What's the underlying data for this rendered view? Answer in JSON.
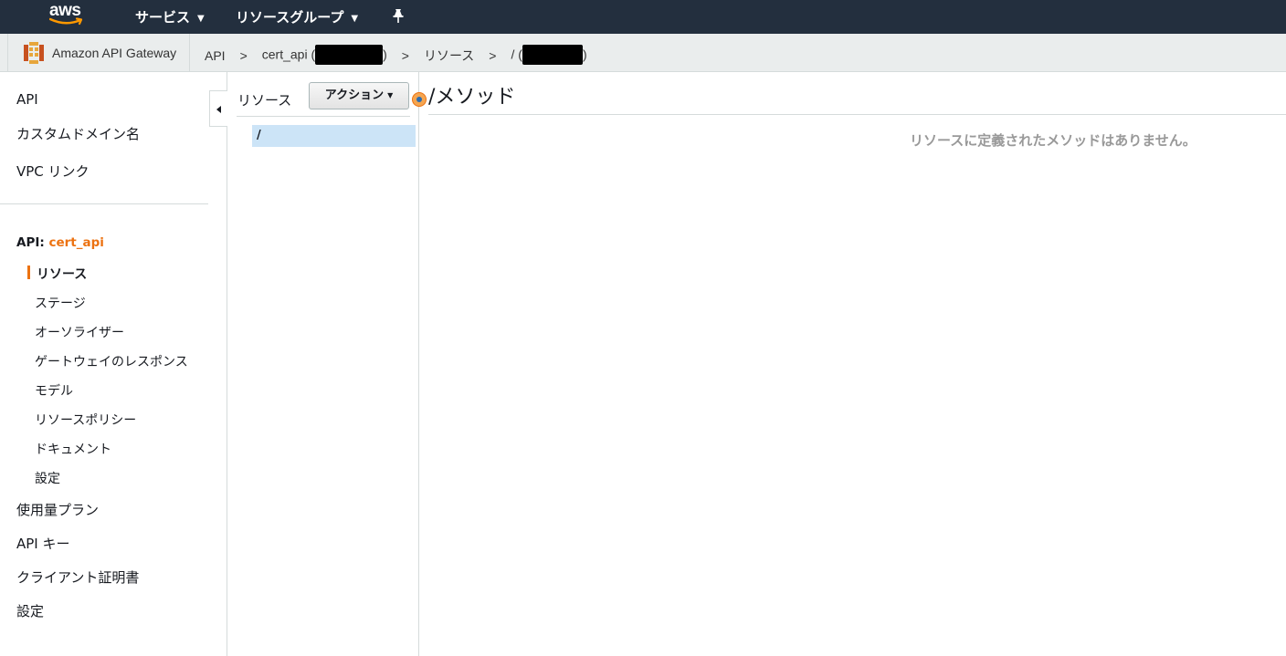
{
  "topbar": {
    "logo_text": "aws",
    "services_label": "サービス",
    "resource_groups_label": "リソースグループ",
    "pin_icon": "pin-icon",
    "colors": {
      "background": "#232f3e",
      "smile": "#ff9900"
    }
  },
  "breadcrumb": {
    "service_name": "Amazon API Gateway",
    "service_icon": "api-gateway-icon",
    "items": [
      "API",
      "cert_api (",
      ")",
      "リソース",
      "/ (",
      ")"
    ],
    "separator": ">"
  },
  "sidebar": {
    "top_items": [
      "API",
      "カスタムドメイン名",
      "VPC リンク"
    ],
    "api_prefix": "API: ",
    "api_name": "cert_api",
    "api_items": [
      "リソース",
      "ステージ",
      "オーソライザー",
      "ゲートウェイのレスポンス",
      "モデル",
      "リソースポリシー",
      "ドキュメント",
      "設定"
    ],
    "active_item": "リソース",
    "bottom_items": [
      "使用量プラン",
      "API キー",
      "クライアント証明書",
      "設定"
    ],
    "accent_color": "#ec7211"
  },
  "resources": {
    "title": "リソース",
    "action_button": "アクション",
    "tree": [
      "/"
    ],
    "selected_color": "#cce4f7"
  },
  "main": {
    "title": "/メソッド",
    "empty_message": "リソースに定義されたメソッドはありません。"
  }
}
